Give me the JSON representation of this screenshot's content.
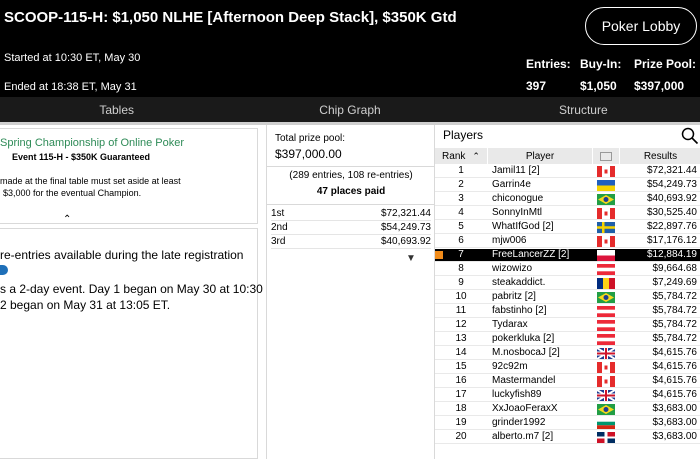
{
  "header": {
    "title": "SCOOP-115-H: $1,050 NLHE [Afternoon Deep Stack], $350K Gtd",
    "lobby_button": "Poker Lobby",
    "started": "Started at 10:30 ET, May 30",
    "ended": "Ended at 18:38 ET, May 31",
    "entries_label": "Entries:",
    "entries_value": "397",
    "buyin_label": "Buy-In:",
    "buyin_value": "$1,050",
    "prize_label": "Prize Pool:",
    "prize_value": "$397,000"
  },
  "tabs": [
    "Tables",
    "Chip Graph",
    "Structure"
  ],
  "info": {
    "card_title": "Spring Championship of Online Poker",
    "card_sub": "Event 115-H - $350K Guaranteed",
    "card_text1": "made at the final table must set aside at least",
    "card_text2": "$3,000 for the eventual Champion.",
    "late_reg": "re-entries available during the late registration",
    "day_text1": "s a 2-day event. Day 1 began on May 30 at 10:30",
    "day_text2": "2 began on May 31 at 13:05 ET."
  },
  "prizes": {
    "label": "Total prize pool:",
    "total": "$397,000.00",
    "entries": "(289 entries, 108 re-entries)",
    "places": "47 places paid",
    "payouts": [
      {
        "place": "1st",
        "amount": "$72,321.44"
      },
      {
        "place": "2nd",
        "amount": "$54,249.73"
      },
      {
        "place": "3rd",
        "amount": "$40,693.92"
      }
    ]
  },
  "players": {
    "title": "Players",
    "col_rank": "Rank",
    "col_player": "Player",
    "col_results": "Results",
    "rows": [
      {
        "rank": "1",
        "name": "Jamil11 [2]",
        "flag": "canada",
        "amount": "$72,321.44"
      },
      {
        "rank": "2",
        "name": "Garrin4e",
        "flag": "ukraine",
        "amount": "$54,249.73"
      },
      {
        "rank": "3",
        "name": "chiconogue",
        "flag": "brazil",
        "amount": "$40,693.92"
      },
      {
        "rank": "4",
        "name": "SonnyInMtl",
        "flag": "canada",
        "amount": "$30,525.40"
      },
      {
        "rank": "5",
        "name": "WhatIfGod [2]",
        "flag": "sweden",
        "amount": "$22,897.76"
      },
      {
        "rank": "6",
        "name": "mjw006",
        "flag": "canada",
        "amount": "$17,176.12"
      },
      {
        "rank": "7",
        "name": "FreeLancerZZ [2]",
        "flag": "poland",
        "amount": "$12,884.19"
      },
      {
        "rank": "8",
        "name": "wizowizo",
        "flag": "austria",
        "amount": "$9,664.68"
      },
      {
        "rank": "9",
        "name": "steakaddict.",
        "flag": "romania",
        "amount": "$7,249.69"
      },
      {
        "rank": "10",
        "name": "pabritz [2]",
        "flag": "brazil",
        "amount": "$5,784.72"
      },
      {
        "rank": "11",
        "name": "fabstinho [2]",
        "flag": "austria",
        "amount": "$5,784.72"
      },
      {
        "rank": "12",
        "name": "Tydarax",
        "flag": "austria",
        "amount": "$5,784.72"
      },
      {
        "rank": "13",
        "name": "pokerkluka [2]",
        "flag": "austria",
        "amount": "$5,784.72"
      },
      {
        "rank": "14",
        "name": "M.nosbocaJ [2]",
        "flag": "uk",
        "amount": "$4,615.76"
      },
      {
        "rank": "15",
        "name": "92c92m",
        "flag": "canada",
        "amount": "$4,615.76"
      },
      {
        "rank": "16",
        "name": "Mastermandel",
        "flag": "canada",
        "amount": "$4,615.76"
      },
      {
        "rank": "17",
        "name": "luckyfish89",
        "flag": "uk",
        "amount": "$4,615.76"
      },
      {
        "rank": "18",
        "name": "XxJoaoFeraxX",
        "flag": "brazil",
        "amount": "$3,683.00"
      },
      {
        "rank": "19",
        "name": "grinder1992",
        "flag": "bulgaria",
        "amount": "$3,683.00"
      },
      {
        "rank": "20",
        "name": "alberto.m7 [2]",
        "flag": "dominican",
        "amount": "$3,683.00"
      }
    ]
  }
}
